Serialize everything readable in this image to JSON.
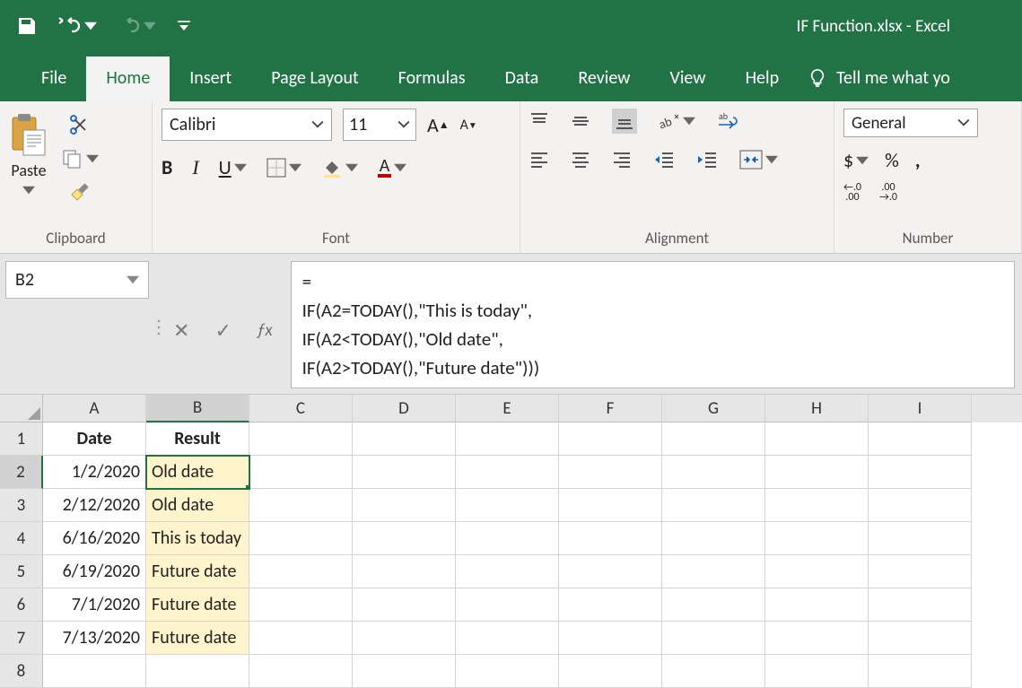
{
  "titlebar": {
    "filename": "IF Function.xlsx",
    "separator": "  -  ",
    "app": "Excel"
  },
  "tabs": {
    "file": "File",
    "home": "Home",
    "insert": "Insert",
    "page_layout": "Page Layout",
    "formulas": "Formulas",
    "data": "Data",
    "review": "Review",
    "view": "View",
    "help": "Help",
    "tell_me": "Tell me what yo"
  },
  "ribbon": {
    "clipboard": {
      "label": "Clipboard",
      "paste": "Paste"
    },
    "font": {
      "label": "Font",
      "name": "Calibri",
      "size": "11",
      "bold": "B",
      "italic": "I",
      "underline": "U"
    },
    "alignment": {
      "label": "Alignment"
    },
    "number": {
      "label": "Number",
      "format": "General",
      "currency": "$",
      "percent": "%",
      "comma": ",",
      "inc_dec": "←.0\n.00",
      "dec_inc": ".00\n→.0"
    }
  },
  "name_box": "B2",
  "formula_bar": "=\nIF(A2=TODAY(),\"This is today\",\nIF(A2<TODAY(),\"Old date\",\nIF(A2>TODAY(),\"Future date\")))",
  "columns": [
    "A",
    "B",
    "C",
    "D",
    "E",
    "F",
    "G",
    "H",
    "I"
  ],
  "selected_col_index": 1,
  "selected_row_index": 1,
  "rows": [
    {
      "n": 1,
      "A": "Date",
      "B": "Result",
      "hdr": true
    },
    {
      "n": 2,
      "A": "1/2/2020",
      "B": "Old date",
      "sel": true
    },
    {
      "n": 3,
      "A": "2/12/2020",
      "B": "Old date"
    },
    {
      "n": 4,
      "A": "6/16/2020",
      "B": "This is today"
    },
    {
      "n": 5,
      "A": "6/19/2020",
      "B": "Future date"
    },
    {
      "n": 6,
      "A": "7/1/2020",
      "B": "Future date"
    },
    {
      "n": 7,
      "A": "7/13/2020",
      "B": "Future date"
    },
    {
      "n": 8,
      "A": "",
      "B": ""
    }
  ]
}
